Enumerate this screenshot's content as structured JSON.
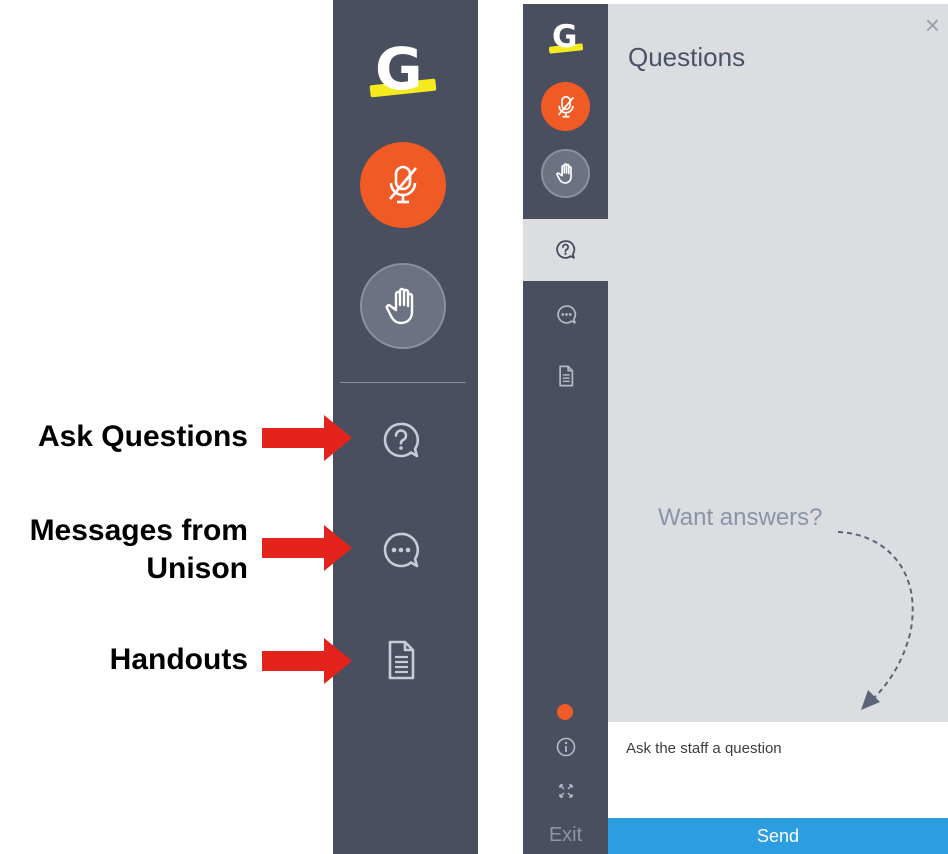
{
  "callouts": {
    "ask_questions": "Ask Questions",
    "messages_line1": "Messages from",
    "messages_line2": "Unison",
    "handouts": "Handouts"
  },
  "logo": {
    "letter": "G"
  },
  "panel": {
    "title": "Questions",
    "close_symbol": "×",
    "want_answers": "Want answers?",
    "input_placeholder": "Ask the staff a question",
    "send_label": "Send"
  },
  "sidebar": {
    "exit_label": "Exit"
  },
  "icons": {
    "mic": "mic-muted-icon",
    "hand": "raise-hand-icon",
    "questions": "question-bubble-icon",
    "messages": "chat-bubble-icon",
    "handouts": "document-icon",
    "info": "info-icon",
    "fullscreen": "fullscreen-icon"
  },
  "colors": {
    "sidebar_bg": "#4a4f5f",
    "mic_orange": "#f05a24",
    "send_blue": "#2d9de2",
    "panel_bg": "#dcdde0",
    "arrow_red": "#e3231c",
    "logo_highlight": "#f4ea1e"
  }
}
